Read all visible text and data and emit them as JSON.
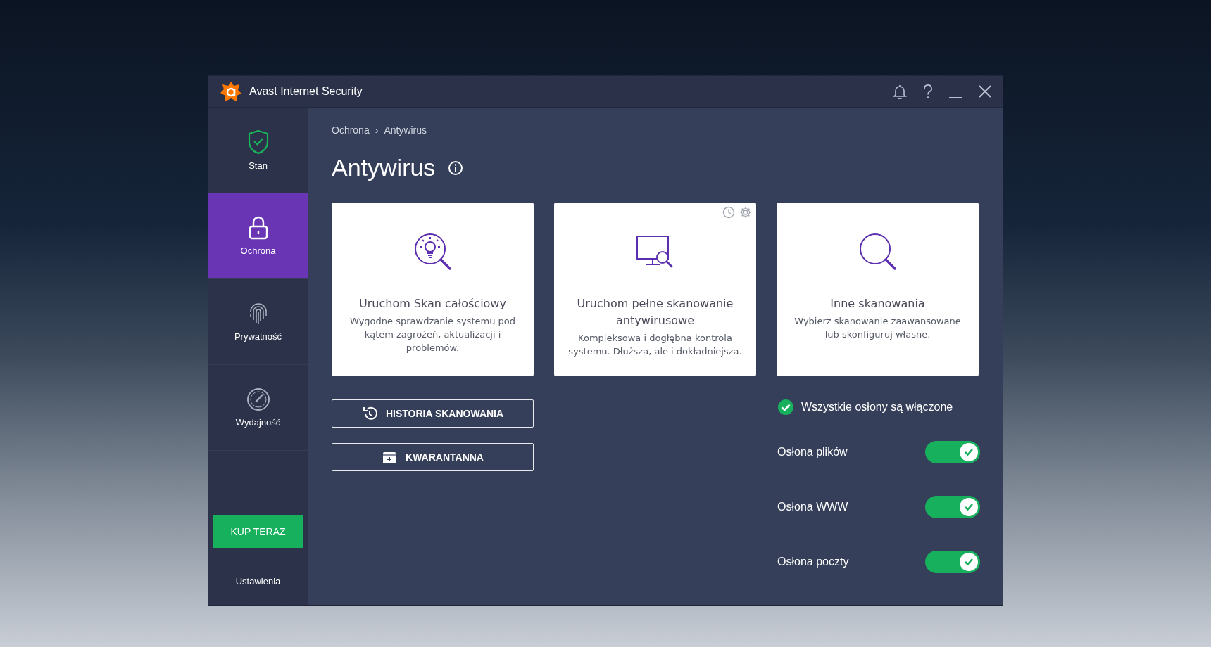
{
  "window": {
    "title": "Avast Internet Security"
  },
  "sidebar": {
    "items": [
      {
        "label": "Stan",
        "selected": false
      },
      {
        "label": "Ochrona",
        "selected": true
      },
      {
        "label": "Prywatność",
        "selected": false
      },
      {
        "label": "Wydajność",
        "selected": false
      }
    ],
    "buy_button": "KUP TERAZ",
    "settings": "Ustawienia"
  },
  "breadcrumb": {
    "items": [
      "Ochrona",
      "Antywirus"
    ],
    "separator": "›"
  },
  "heading": "Antywirus",
  "cards": [
    {
      "title": "Uruchom Skan całościowy",
      "description": "Wygodne sprawdzanie systemu pod kątem zagrożeń, aktualizacji i problemów.",
      "corner_icons": false
    },
    {
      "title": "Uruchom pełne skanowanie antywirusowe",
      "description": "Kompleksowa i dogłębna kontrola systemu. Dłuższa, ale i dokładniejsza.",
      "corner_icons": true
    },
    {
      "title": "Inne skanowania",
      "description": "Wybierz skanowanie zaawansowane lub skonfiguruj własne.",
      "corner_icons": false
    }
  ],
  "actions": [
    "HISTORIA SKANOWANIA",
    "KWARANTANNA"
  ],
  "shields": {
    "status": "Wszystkie osłony są włączone",
    "items": [
      {
        "label": "Osłona plików",
        "on": true
      },
      {
        "label": "Osłona WWW",
        "on": true
      },
      {
        "label": "Osłona poczty",
        "on": true
      }
    ]
  }
}
